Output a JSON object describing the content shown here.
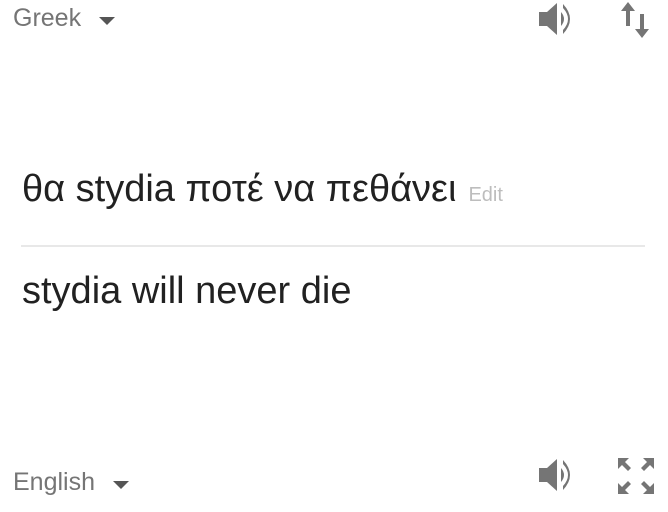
{
  "source": {
    "language": "Greek",
    "text": "θα stydia ποτέ να πεθάνει",
    "edit_label": "Edit"
  },
  "target": {
    "language": "English",
    "text": "stydia will never die"
  },
  "icons": {
    "speaker_top": "speaker-icon",
    "swap": "swap-languages-icon",
    "speaker_bottom": "speaker-icon",
    "expand": "fullscreen-icon"
  },
  "colors": {
    "text": "#212121",
    "muted": "#757575",
    "icon": "#757575",
    "edit": "#bdbdbd",
    "divider": "#e8e8e8"
  }
}
